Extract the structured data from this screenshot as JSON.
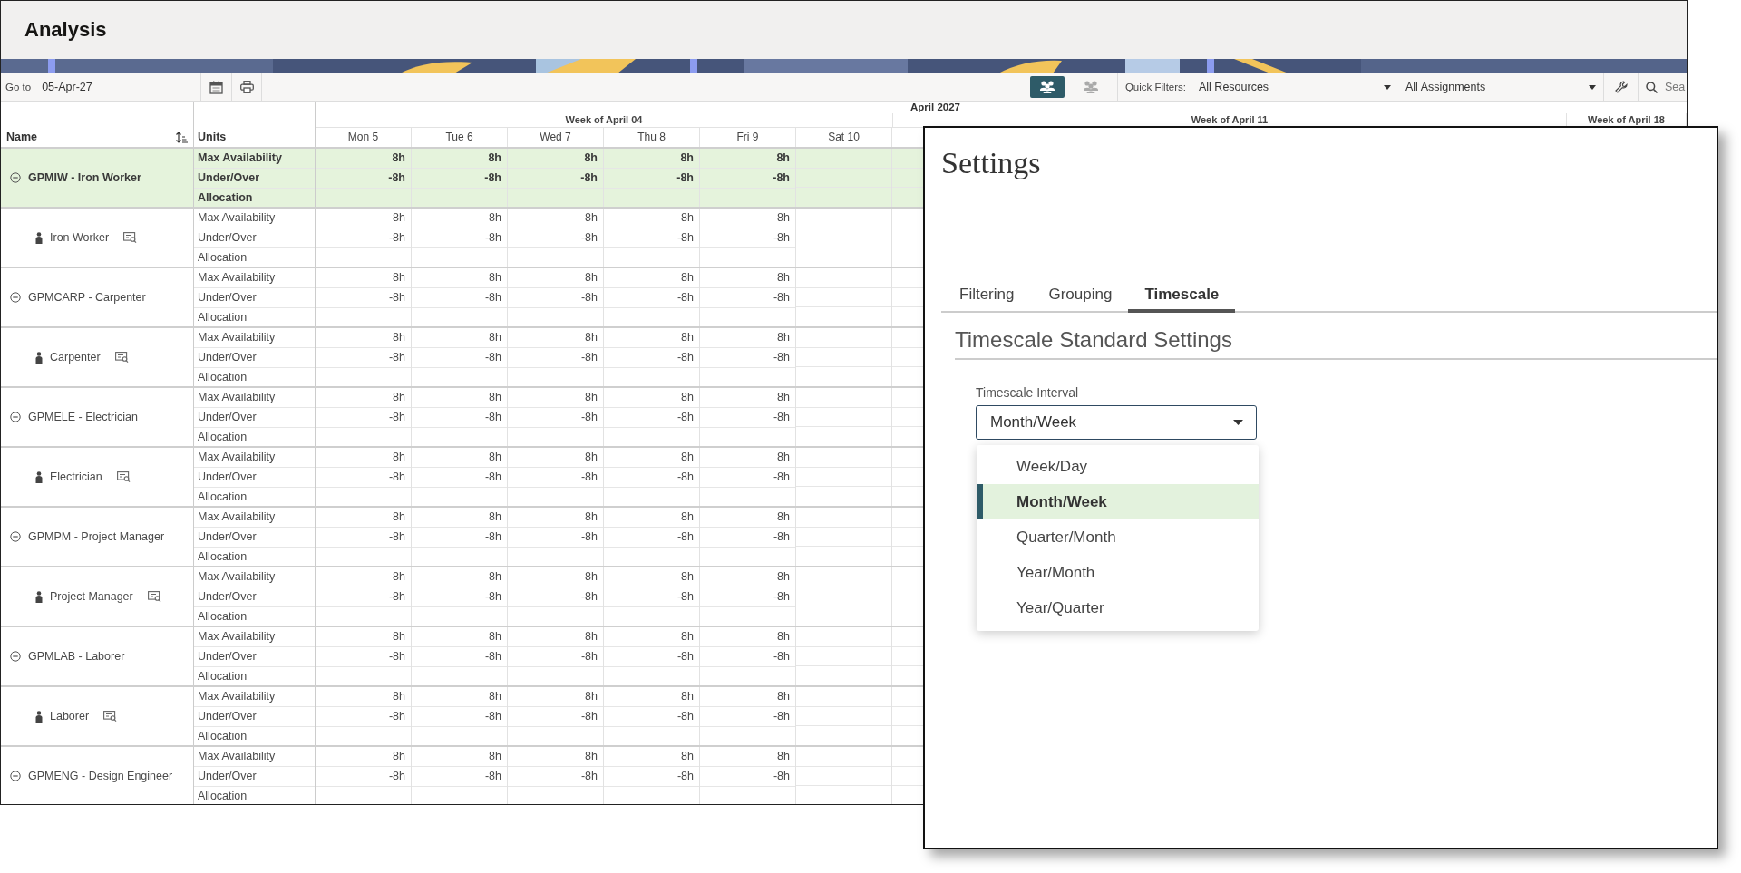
{
  "page": {
    "title": "Analysis"
  },
  "toolbar": {
    "goto_label": "Go to",
    "date": "05-Apr-27",
    "view_toggles": [
      {
        "selected": true
      },
      {
        "selected": false
      }
    ],
    "quick_filters_label": "Quick Filters:",
    "filters": [
      "All Resources",
      "All Assignments"
    ],
    "search_placeholder": "Sea"
  },
  "timescale": {
    "month": "April 2027",
    "weeks": [
      "Week of April 04",
      "Week of April 11",
      "Week of April 18"
    ],
    "days": [
      "Mon 5",
      "Tue 6",
      "Wed 7",
      "Thu 8",
      "Fri 9",
      "Sat 10"
    ]
  },
  "table": {
    "columns": [
      "Name",
      "Units"
    ],
    "rows": [
      {
        "kind": "group",
        "name": "GPMIW - Iron Worker",
        "expanded": true,
        "selected": true,
        "measures": [
          {
            "label": "Max Availability",
            "values": [
              "8h",
              "8h",
              "8h",
              "8h",
              "8h"
            ]
          },
          {
            "label": "Under/Over",
            "values": [
              "-8h",
              "-8h",
              "-8h",
              "-8h",
              "-8h"
            ]
          },
          {
            "label": "Allocation"
          }
        ]
      },
      {
        "kind": "resource",
        "name": "Iron Worker",
        "selected": false,
        "measures": [
          {
            "label": "Max Availability",
            "values": [
              "8h",
              "8h",
              "8h",
              "8h",
              "8h"
            ]
          },
          {
            "label": "Under/Over",
            "values": [
              "-8h",
              "-8h",
              "-8h",
              "-8h",
              "-8h"
            ]
          },
          {
            "label": "Allocation"
          }
        ]
      },
      {
        "kind": "group",
        "name": "GPMCARP - Carpenter",
        "expanded": true,
        "selected": false,
        "measures": [
          {
            "label": "Max Availability",
            "values": [
              "8h",
              "8h",
              "8h",
              "8h",
              "8h"
            ]
          },
          {
            "label": "Under/Over",
            "values": [
              "-8h",
              "-8h",
              "-8h",
              "-8h",
              "-8h"
            ]
          },
          {
            "label": "Allocation"
          }
        ]
      },
      {
        "kind": "resource",
        "name": "Carpenter",
        "selected": false,
        "measures": [
          {
            "label": "Max Availability",
            "values": [
              "8h",
              "8h",
              "8h",
              "8h",
              "8h"
            ]
          },
          {
            "label": "Under/Over",
            "values": [
              "-8h",
              "-8h",
              "-8h",
              "-8h",
              "-8h"
            ]
          },
          {
            "label": "Allocation"
          }
        ]
      },
      {
        "kind": "group",
        "name": "GPMELE - Electrician",
        "expanded": true,
        "selected": false,
        "measures": [
          {
            "label": "Max Availability",
            "values": [
              "8h",
              "8h",
              "8h",
              "8h",
              "8h"
            ]
          },
          {
            "label": "Under/Over",
            "values": [
              "-8h",
              "-8h",
              "-8h",
              "-8h",
              "-8h"
            ]
          },
          {
            "label": "Allocation"
          }
        ]
      },
      {
        "kind": "resource",
        "name": "Electrician",
        "selected": false,
        "measures": [
          {
            "label": "Max Availability",
            "values": [
              "8h",
              "8h",
              "8h",
              "8h",
              "8h"
            ]
          },
          {
            "label": "Under/Over",
            "values": [
              "-8h",
              "-8h",
              "-8h",
              "-8h",
              "-8h"
            ]
          },
          {
            "label": "Allocation"
          }
        ]
      },
      {
        "kind": "group",
        "name": "GPMPM - Project Manager",
        "expanded": true,
        "selected": false,
        "measures": [
          {
            "label": "Max Availability",
            "values": [
              "8h",
              "8h",
              "8h",
              "8h",
              "8h"
            ]
          },
          {
            "label": "Under/Over",
            "values": [
              "-8h",
              "-8h",
              "-8h",
              "-8h",
              "-8h"
            ]
          },
          {
            "label": "Allocation"
          }
        ]
      },
      {
        "kind": "resource",
        "name": "Project Manager",
        "selected": false,
        "measures": [
          {
            "label": "Max Availability",
            "values": [
              "8h",
              "8h",
              "8h",
              "8h",
              "8h"
            ]
          },
          {
            "label": "Under/Over",
            "values": [
              "-8h",
              "-8h",
              "-8h",
              "-8h",
              "-8h"
            ]
          },
          {
            "label": "Allocation"
          }
        ]
      },
      {
        "kind": "group",
        "name": "GPMLAB - Laborer",
        "expanded": true,
        "selected": false,
        "measures": [
          {
            "label": "Max Availability",
            "values": [
              "8h",
              "8h",
              "8h",
              "8h",
              "8h"
            ]
          },
          {
            "label": "Under/Over",
            "values": [
              "-8h",
              "-8h",
              "-8h",
              "-8h",
              "-8h"
            ]
          },
          {
            "label": "Allocation"
          }
        ]
      },
      {
        "kind": "resource",
        "name": "Laborer",
        "selected": false,
        "measures": [
          {
            "label": "Max Availability",
            "values": [
              "8h",
              "8h",
              "8h",
              "8h",
              "8h"
            ]
          },
          {
            "label": "Under/Over",
            "values": [
              "-8h",
              "-8h",
              "-8h",
              "-8h",
              "-8h"
            ]
          },
          {
            "label": "Allocation"
          }
        ]
      },
      {
        "kind": "group",
        "name": "GPMENG - Design Engineer",
        "expanded": true,
        "selected": false,
        "measures": [
          {
            "label": "Max Availability",
            "values": [
              "8h",
              "8h",
              "8h",
              "8h",
              "8h"
            ]
          },
          {
            "label": "Under/Over",
            "values": [
              "-8h",
              "-8h",
              "-8h",
              "-8h",
              "-8h"
            ]
          },
          {
            "label": "Allocation"
          }
        ]
      }
    ]
  },
  "dialog": {
    "title": "Settings",
    "tabs": [
      {
        "label": "Filtering",
        "selected": false
      },
      {
        "label": "Grouping",
        "selected": false
      },
      {
        "label": "Timescale",
        "selected": true
      }
    ],
    "section": "Timescale Standard Settings",
    "field": {
      "label": "Timescale Interval",
      "value": "Month/Week",
      "options": [
        {
          "label": "Week/Day",
          "selected": false
        },
        {
          "label": "Month/Week",
          "selected": true
        },
        {
          "label": "Quarter/Month",
          "selected": false
        },
        {
          "label": "Year/Month",
          "selected": false
        },
        {
          "label": "Year/Quarter",
          "selected": false
        }
      ]
    }
  }
}
